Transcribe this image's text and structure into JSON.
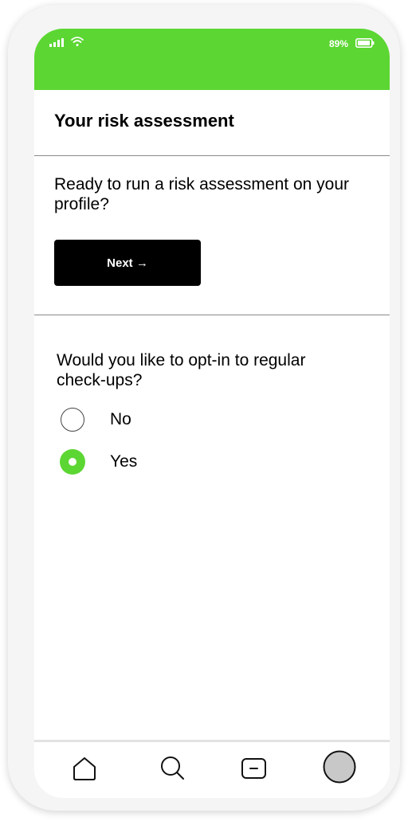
{
  "status_bar": {
    "battery_percent": "89%",
    "signal_icon": "signal-bars-icon",
    "wifi_icon": "wifi-icon",
    "battery_icon": "battery-icon",
    "background_color": "#5cd633"
  },
  "header": {
    "title": "Your risk assessment"
  },
  "assessment": {
    "prompt": "Ready to run a risk assessment on your profile?",
    "next_label": "Next →"
  },
  "checkups": {
    "question": "Would you like to opt-in to regular check-ups?",
    "options": [
      {
        "label": "No",
        "selected": false
      },
      {
        "label": "Yes",
        "selected": true
      }
    ]
  },
  "bottom_nav": {
    "items": [
      {
        "icon": "home-icon"
      },
      {
        "icon": "search-icon"
      },
      {
        "icon": "message-icon"
      },
      {
        "icon": "profile-avatar-icon"
      }
    ]
  },
  "colors": {
    "accent": "#5cd633",
    "button_bg": "#000000",
    "text": "#000000"
  }
}
